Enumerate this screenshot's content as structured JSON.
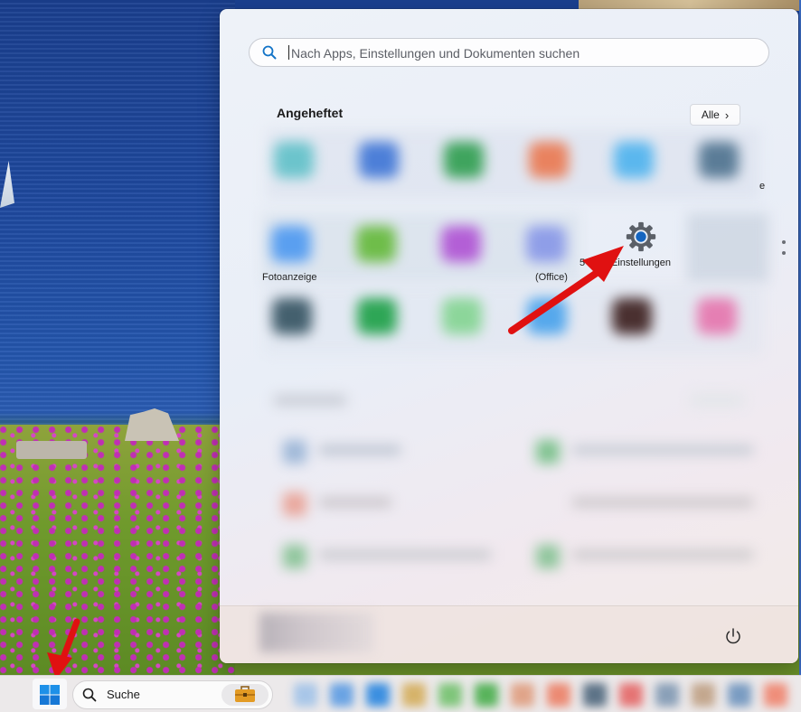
{
  "search": {
    "placeholder": "Nach Apps, Einstellungen und Dokumenten suchen"
  },
  "pinned": {
    "title": "Angeheftet",
    "all_button": "Alle",
    "partial_labels": {
      "fotoanzeige": "Fotoanzeige",
      "office": "(Office)",
      "num": "5",
      "edge_e": "e"
    },
    "settings_label": "Einstellungen"
  },
  "taskbar": {
    "search_label": "Suche"
  },
  "colors": {
    "settings_gear": "#5b6068",
    "settings_core": "#1565c0",
    "arrow": "#e01111",
    "start_logo": "#1e90e8"
  }
}
